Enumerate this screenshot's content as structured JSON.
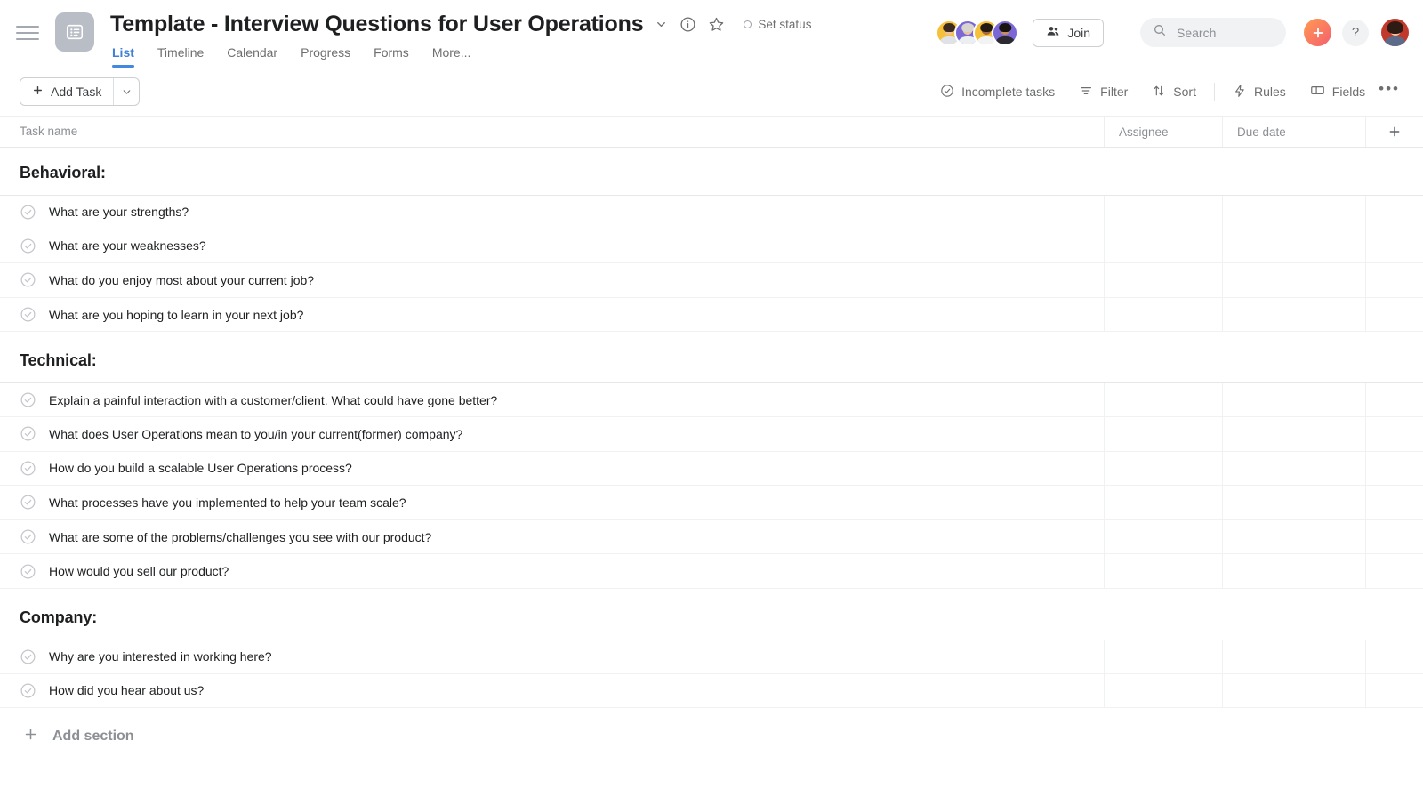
{
  "header": {
    "menu_icon": "hamburger-icon",
    "project_icon": "list-project-icon",
    "title": "Template - Interview Questions for User Operations",
    "title_chevron_icon": "chevron-down-icon",
    "info_icon": "info-circle-icon",
    "star_icon": "star-icon",
    "set_status_label": "Set status",
    "tabs": [
      {
        "label": "List",
        "active": true
      },
      {
        "label": "Timeline",
        "active": false
      },
      {
        "label": "Calendar",
        "active": false
      },
      {
        "label": "Progress",
        "active": false
      },
      {
        "label": "Forms",
        "active": false
      },
      {
        "label": "More...",
        "active": false
      }
    ],
    "members": [
      {
        "bg": "#f5c13a",
        "skin": "#f0c19a",
        "hair": "#3b2a20",
        "shirt": "#dfe3e8"
      },
      {
        "bg": "#7b68d6",
        "skin": "#e8c3a0",
        "hair": "#d8d5d0",
        "shirt": "#eceff2"
      },
      {
        "bg": "#f5c13a",
        "skin": "#a8693f",
        "hair": "#241a14",
        "shirt": "#f2f3f5"
      },
      {
        "bg": "#7b68d6",
        "skin": "#c88d5c",
        "hair": "#1a1410",
        "shirt": "#2a2a30"
      }
    ],
    "join_label": "Join",
    "join_icon": "people-icon",
    "search_icon": "search-icon",
    "search_placeholder": "Search",
    "search_value": "",
    "create_icon": "plus-icon",
    "help_label": "?",
    "account_avatar": "user-avatar"
  },
  "toolbar": {
    "add_task_label": "Add Task",
    "add_task_plus_icon": "plus-icon",
    "add_task_chevron_icon": "chevron-down-icon",
    "filters": [
      {
        "label": "Incomplete tasks",
        "icon": "check-circle-icon"
      },
      {
        "label": "Filter",
        "icon": "filter-icon"
      },
      {
        "label": "Sort",
        "icon": "sort-arrows-icon"
      }
    ],
    "actions": [
      {
        "label": "Rules",
        "icon": "bolt-icon"
      },
      {
        "label": "Fields",
        "icon": "fields-icon"
      }
    ],
    "more_label": "•••"
  },
  "table": {
    "columns": [
      {
        "key": "task_name",
        "label": "Task name"
      },
      {
        "key": "assignee",
        "label": "Assignee"
      },
      {
        "key": "due_date",
        "label": "Due date"
      }
    ],
    "add_column_icon": "plus-icon",
    "sections": [
      {
        "title": "Behavioral:",
        "tasks": [
          {
            "name": "What are your strengths?",
            "assignee": "",
            "due_date": ""
          },
          {
            "name": "What are your weaknesses?",
            "assignee": "",
            "due_date": ""
          },
          {
            "name": "What do you enjoy most about your current job?",
            "assignee": "",
            "due_date": ""
          },
          {
            "name": "What are you hoping to learn in your next job?",
            "assignee": "",
            "due_date": ""
          }
        ]
      },
      {
        "title": "Technical:",
        "tasks": [
          {
            "name": "Explain a painful interaction with a customer/client. What could have gone better?",
            "assignee": "",
            "due_date": ""
          },
          {
            "name": "What does User Operations mean to you/in your current(former) company?",
            "assignee": "",
            "due_date": ""
          },
          {
            "name": "How do you build a scalable User Operations process?",
            "assignee": "",
            "due_date": ""
          },
          {
            "name": "What processes have you implemented to help your team scale?",
            "assignee": "",
            "due_date": ""
          },
          {
            "name": "What are some of the problems/challenges you see with our product?",
            "assignee": "",
            "due_date": ""
          },
          {
            "name": "How would you sell our product?",
            "assignee": "",
            "due_date": ""
          }
        ]
      },
      {
        "title": "Company:",
        "tasks": [
          {
            "name": "Why are you interested in working here?",
            "assignee": "",
            "due_date": ""
          },
          {
            "name": "How did you hear about us?",
            "assignee": "",
            "due_date": ""
          }
        ]
      }
    ],
    "add_section_label": "Add section",
    "add_section_icon": "plus-icon"
  },
  "colors": {
    "accent_blue": "#4088e0",
    "create_gradient_start": "#ff9a52",
    "create_gradient_end": "#f45f6e",
    "text_primary": "#1e1f21",
    "text_muted": "#6d6e6f"
  }
}
